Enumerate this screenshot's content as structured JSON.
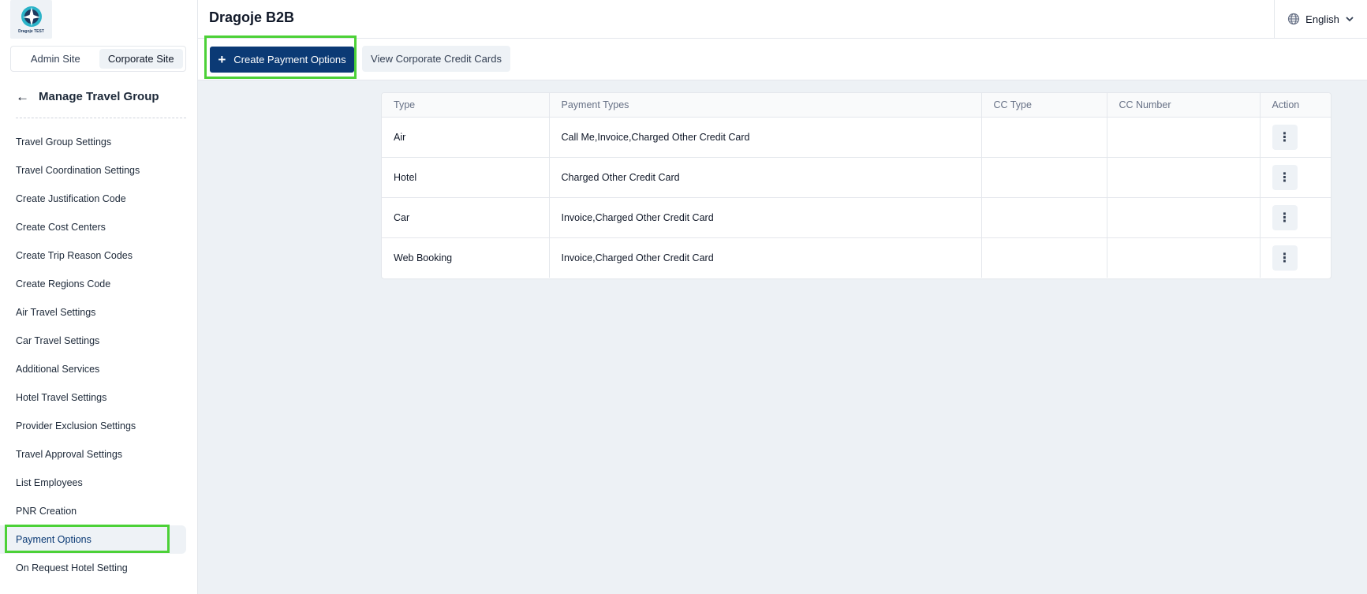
{
  "app": {
    "title": "Dragoje B2B",
    "logo_caption": "Dragoje TEST"
  },
  "site_switch": {
    "admin_label": "Admin Site",
    "corporate_label": "Corporate Site",
    "selected": "Corporate Site"
  },
  "sidebar": {
    "section_title": "Manage Travel Group",
    "items": [
      {
        "label": "Travel Group Settings"
      },
      {
        "label": "Travel Coordination Settings"
      },
      {
        "label": "Create Justification Code"
      },
      {
        "label": "Create Cost Centers"
      },
      {
        "label": "Create Trip Reason Codes"
      },
      {
        "label": "Create Regions Code"
      },
      {
        "label": "Air Travel Settings"
      },
      {
        "label": "Car Travel Settings"
      },
      {
        "label": "Additional Services"
      },
      {
        "label": "Hotel Travel Settings"
      },
      {
        "label": "Provider Exclusion Settings"
      },
      {
        "label": "Travel Approval Settings"
      },
      {
        "label": "List Employees"
      },
      {
        "label": "PNR Creation"
      },
      {
        "label": "Payment Options"
      },
      {
        "label": "On Request Hotel Setting"
      }
    ],
    "active": "Payment Options"
  },
  "header": {
    "language": "English"
  },
  "toolbar": {
    "create_label": "Create Payment Options",
    "view_cards_label": "View Corporate Credit Cards"
  },
  "table": {
    "columns": [
      "Type",
      "Payment Types",
      "CC Type",
      "CC Number",
      "Action"
    ],
    "rows": [
      {
        "type": "Air",
        "payment_types": "Call Me,Invoice,Charged Other Credit Card",
        "cc_type": "",
        "cc_number": ""
      },
      {
        "type": "Hotel",
        "payment_types": "Charged Other Credit Card",
        "cc_type": "",
        "cc_number": ""
      },
      {
        "type": "Car",
        "payment_types": "Invoice,Charged Other Credit Card",
        "cc_type": "",
        "cc_number": ""
      },
      {
        "type": "Web Booking",
        "payment_types": "Invoice,Charged Other Credit Card",
        "cc_type": "",
        "cc_number": ""
      }
    ]
  },
  "colors": {
    "primary": "#0b3a75",
    "highlight": "#4cd137",
    "background": "#edf1f5"
  }
}
